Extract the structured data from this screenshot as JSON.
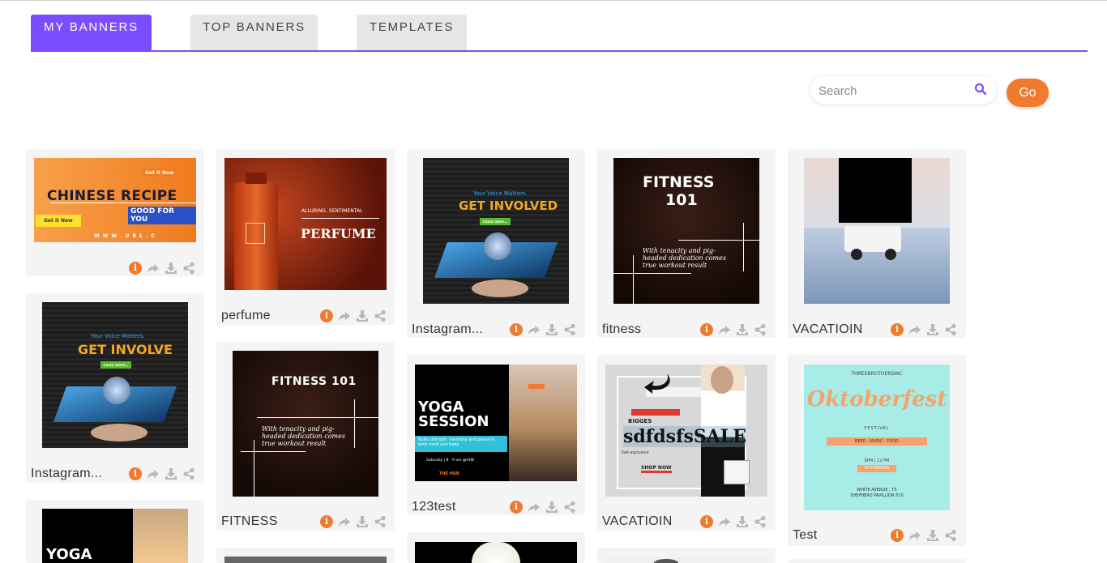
{
  "tabs": [
    {
      "label": "MY BANNERS",
      "active": true
    },
    {
      "label": "TOP BANNERS",
      "active": false
    },
    {
      "label": "TEMPLATES",
      "active": false
    }
  ],
  "search": {
    "placeholder": "Search",
    "go_label": "Go"
  },
  "colors": {
    "accent": "#7c4dff",
    "button": "#f07a2e",
    "card_bg": "#f4f4f4"
  },
  "cards": [
    {
      "name": "",
      "thumb_text": [
        "CHINESE RECIPE",
        "GOOD FOR YOU",
        "Get it Now",
        "Get it Now",
        "W W W . U R L . C"
      ]
    },
    {
      "name": "Instagram...",
      "thumb_text": [
        "Your Voice Matters.",
        "GET INVOLVE",
        "Learn more..."
      ]
    },
    {
      "name": "",
      "thumb_text": [
        "YOGA"
      ]
    },
    {
      "name": "perfume",
      "thumb_text": [
        "ALLURING. SENTIMENTAL",
        "PERFUME"
      ]
    },
    {
      "name": "FITNESS",
      "thumb_text": [
        "FITNESS 101",
        "With tenacity and pig-headed dedication comes true workout result"
      ]
    },
    {
      "name": "Instagram...",
      "thumb_text": [
        "Your Voice Matters.",
        "GET INVOLVED",
        "Learn more..."
      ]
    },
    {
      "name": "123test",
      "thumb_text": [
        "YOGA",
        "SESSION",
        "Build strength, harmony and peace in both mind and body",
        "Saturday | 8 - 9 am @HUB",
        "THE HUB"
      ]
    },
    {
      "name": "fitness",
      "thumb_text": [
        "FITNESS",
        "101",
        "With tenacity and pig-headed dedication comes true workout result"
      ]
    },
    {
      "name": "VACATIOIN",
      "thumb_text": [
        "BIGGES",
        "sdfdsfsSALE",
        "Get exclusive",
        "SHOP NOW"
      ]
    },
    {
      "name": "VACATIOIN",
      "thumb_text": []
    },
    {
      "name": "Test",
      "thumb_text": [
        "THREEBROTHERSINC",
        "Oktoberfest",
        "FESTIVAL",
        "BEER - MUSIC - FOOD",
        "6PM | 12 PM",
        "OCTOBER25",
        "WHITE AVENUE , TX",
        "SHEPHERD PAVILLION 510"
      ]
    }
  ]
}
